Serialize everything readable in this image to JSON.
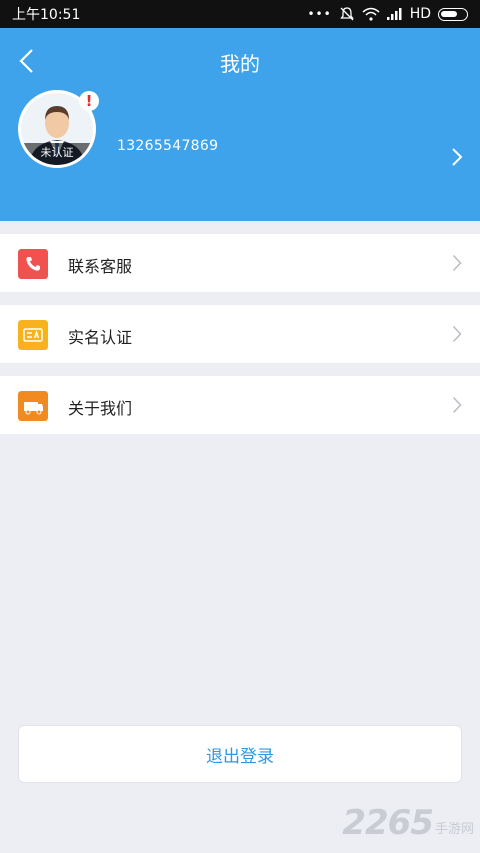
{
  "status_bar": {
    "time": "上午10:51",
    "network_label": "HD"
  },
  "header": {
    "title": "我的",
    "avatar_badge": "未认证",
    "alert_mark": "!",
    "phone": "13265547869",
    "bg_color": "#3EA3EB"
  },
  "menu": {
    "items": [
      {
        "label": "联系客服",
        "icon": "phone-icon",
        "color": "#F0524F"
      },
      {
        "label": "实名认证",
        "icon": "id-card-icon",
        "color": "#F7B21E"
      },
      {
        "label": "关于我们",
        "icon": "about-icon",
        "color": "#F28A22"
      }
    ]
  },
  "logout": {
    "label": "退出登录"
  },
  "watermark": {
    "number": "2265",
    "text": "手游网"
  }
}
